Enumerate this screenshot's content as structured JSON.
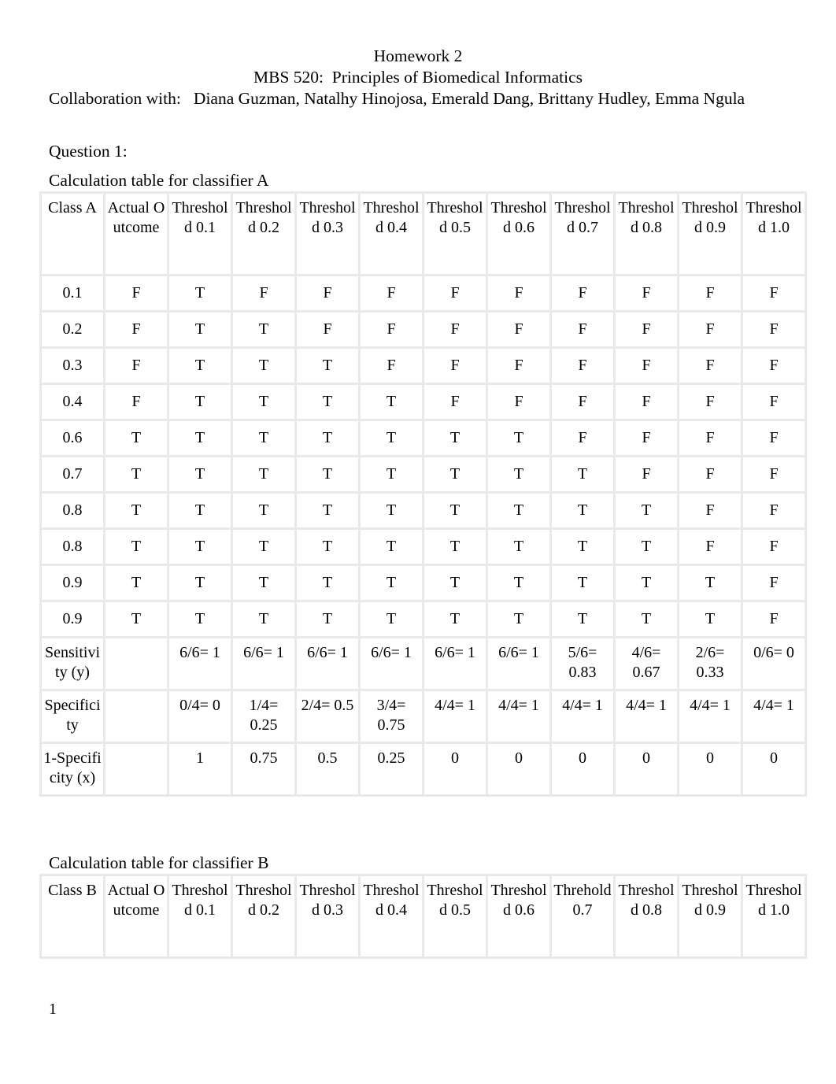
{
  "document": {
    "title_line1": "Homework 2",
    "title_line2": "MBS 520:  Principles of Biomedical Informatics",
    "collaboration": "Collaboration with:   Diana Guzman, Natalhy Hinojosa, Emerald Dang, Brittany Hudley, Emma Ngula",
    "question_label": "Question 1:",
    "caption_a": "Calculation table for classifier A",
    "caption_b": "Calculation table for classifier B",
    "page_number": "1"
  },
  "table_a": {
    "headers": [
      "Class A",
      "Actual Outcome",
      "Threshold 0.1",
      "Threshold 0.2",
      "Threshold 0.3",
      "Threshold 0.4",
      "Threshold 0.5",
      "Threshold 0.6",
      "Threshold 0.7",
      "Threshold 0.8",
      "Threshold 0.9",
      "Threshold 1.0"
    ],
    "rows": [
      [
        "0.1",
        "F",
        "T",
        "F",
        "F",
        "F",
        "F",
        "F",
        "F",
        "F",
        "F",
        "F"
      ],
      [
        "0.2",
        "F",
        "T",
        "T",
        "F",
        "F",
        "F",
        "F",
        "F",
        "F",
        "F",
        "F"
      ],
      [
        "0.3",
        "F",
        "T",
        "T",
        "T",
        "F",
        "F",
        "F",
        "F",
        "F",
        "F",
        "F"
      ],
      [
        "0.4",
        "F",
        "T",
        "T",
        "T",
        "T",
        "F",
        "F",
        "F",
        "F",
        "F",
        "F"
      ],
      [
        "0.6",
        "T",
        "T",
        "T",
        "T",
        "T",
        "T",
        "T",
        "F",
        "F",
        "F",
        "F"
      ],
      [
        "0.7",
        "T",
        "T",
        "T",
        "T",
        "T",
        "T",
        "T",
        "T",
        "F",
        "F",
        "F"
      ],
      [
        "0.8",
        "T",
        "T",
        "T",
        "T",
        "T",
        "T",
        "T",
        "T",
        "T",
        "F",
        "F"
      ],
      [
        "0.8",
        "T",
        "T",
        "T",
        "T",
        "T",
        "T",
        "T",
        "T",
        "T",
        "F",
        "F"
      ],
      [
        "0.9",
        "T",
        "T",
        "T",
        "T",
        "T",
        "T",
        "T",
        "T",
        "T",
        "T",
        "F"
      ],
      [
        "0.9",
        "T",
        "T",
        "T",
        "T",
        "T",
        "T",
        "T",
        "T",
        "T",
        "T",
        "F"
      ]
    ],
    "summary_rows": [
      {
        "label": "Sensitivity (y)",
        "values": [
          "",
          "6/6= 1",
          "6/6= 1",
          "6/6= 1",
          "6/6= 1",
          "6/6= 1",
          "6/6= 1",
          "5/6= 0.83",
          "4/6= 0.67",
          "2/6= 0.33",
          "0/6= 0"
        ]
      },
      {
        "label": "Specificity",
        "values": [
          "",
          "0/4= 0",
          "1/4= 0.25",
          "2/4= 0.5",
          "3/4= 0.75",
          "4/4= 1",
          "4/4= 1",
          "4/4= 1",
          "4/4= 1",
          "4/4= 1",
          "4/4= 1"
        ]
      },
      {
        "label": "1-Specificity (x)",
        "values": [
          "",
          "1",
          "0.75",
          "0.5",
          "0.25",
          "0",
          "0",
          "0",
          "0",
          "0",
          "0"
        ]
      }
    ]
  },
  "table_b": {
    "headers": [
      "Class B",
      "Actual Outcome",
      "Threshold 0.1",
      "Threshold 0.2",
      "Threshold 0.3",
      "Threshold 0.4",
      "Threshold 0.5",
      "Threshold 0.6",
      "Threhold 0.7",
      "Threshold 0.8",
      "Threshold 0.9",
      "Threshold 1.0"
    ]
  }
}
